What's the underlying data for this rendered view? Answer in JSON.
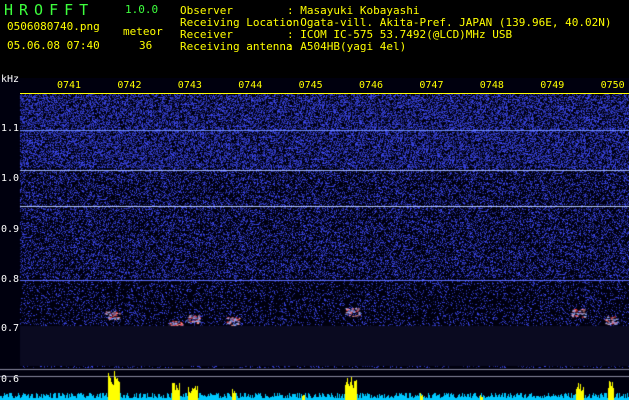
{
  "app": {
    "name": "HROFFT",
    "version": "1.0.0"
  },
  "file": {
    "name": "0506080740.png",
    "datetime": "05.06.08 07:40"
  },
  "counter": {
    "label": "meteor",
    "value": "36"
  },
  "info": {
    "observer_label": "Observer",
    "observer_value": ": Masayuki Kobayashi",
    "location_label": "Receiving Location",
    "location_value": ": Ogata-vill. Akita-Pref. JAPAN (139.96E, 40.02N)",
    "receiver_label": "Receiver",
    "receiver_value": ": ICOM IC-575 53.7492(@LCD)MHz USB",
    "antenna_label": "Receiving antenna",
    "antenna_value": ": A504HB(yagi 4el)"
  },
  "axis": {
    "unit": "kHz",
    "y_ticks": [
      "1.1",
      "1.0",
      "0.9",
      "0.8",
      "0.7",
      "0.6"
    ],
    "time_ticks": [
      "0741",
      "0742",
      "0743",
      "0744",
      "0745",
      "0746",
      "0747",
      "0748",
      "0749",
      "0750"
    ]
  },
  "colors": {
    "background": "#000010",
    "noise": "#2a3cff",
    "meteor": "#ff6060",
    "level": "#ffff00",
    "baseline": "#00d8ff"
  }
}
